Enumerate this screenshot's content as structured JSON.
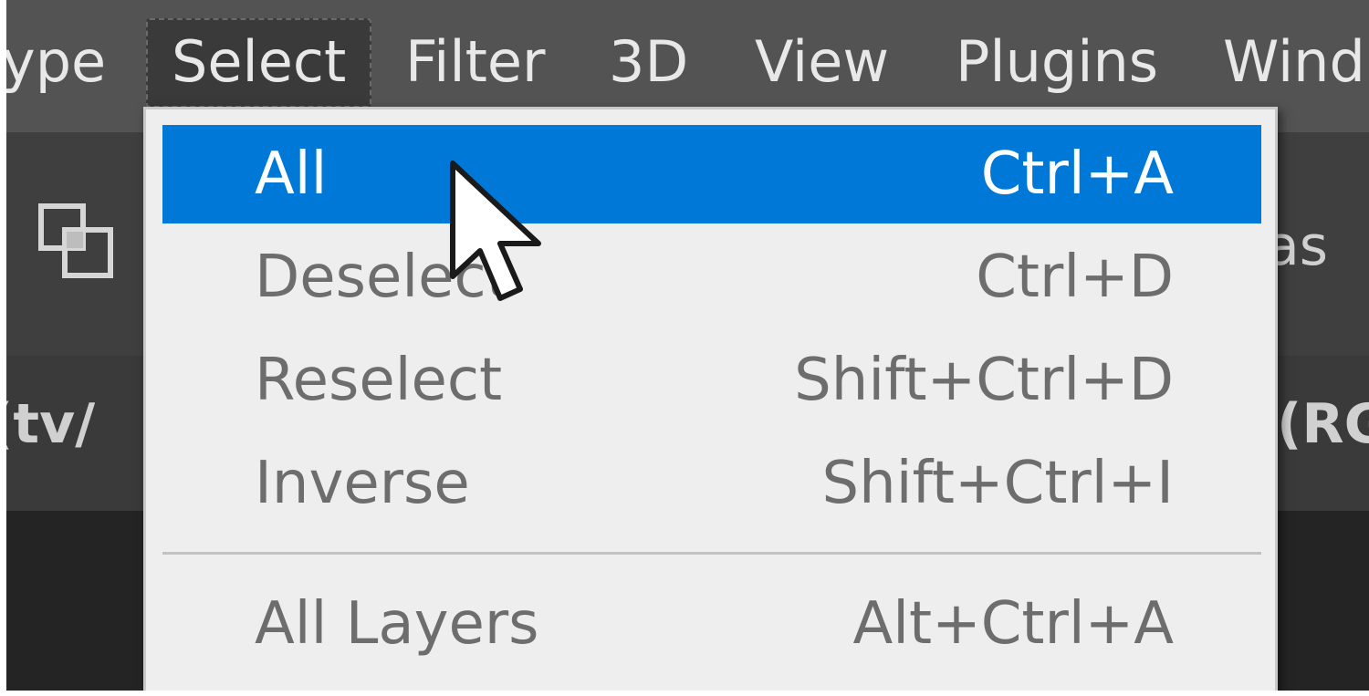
{
  "menubar": {
    "items": [
      {
        "label": "ype"
      },
      {
        "label": "Select",
        "active": true
      },
      {
        "label": "Filter"
      },
      {
        "label": "3D"
      },
      {
        "label": "View"
      },
      {
        "label": "Plugins"
      },
      {
        "label": "Wind"
      }
    ]
  },
  "background_fragments": {
    "options_right": "as",
    "tab_left": "(tv/",
    "tab_right": "(RG"
  },
  "select_menu": {
    "items": [
      {
        "label": "All",
        "shortcut": "Ctrl+A",
        "highlighted": true
      },
      {
        "label": "Deselect",
        "shortcut": "Ctrl+D"
      },
      {
        "label": "Reselect",
        "shortcut": "Shift+Ctrl+D"
      },
      {
        "label": "Inverse",
        "shortcut": "Shift+Ctrl+I"
      },
      {
        "label": "All Layers",
        "shortcut": "Alt+Ctrl+A"
      }
    ]
  },
  "icons": {
    "cursor": "mouse-pointer-icon",
    "options": "overlap-squares-icon"
  },
  "colors": {
    "highlight": "#0078d7",
    "menubar": "#535353",
    "dropdown_bg": "#eeeeee",
    "disabled_text": "#6d6d6d"
  }
}
